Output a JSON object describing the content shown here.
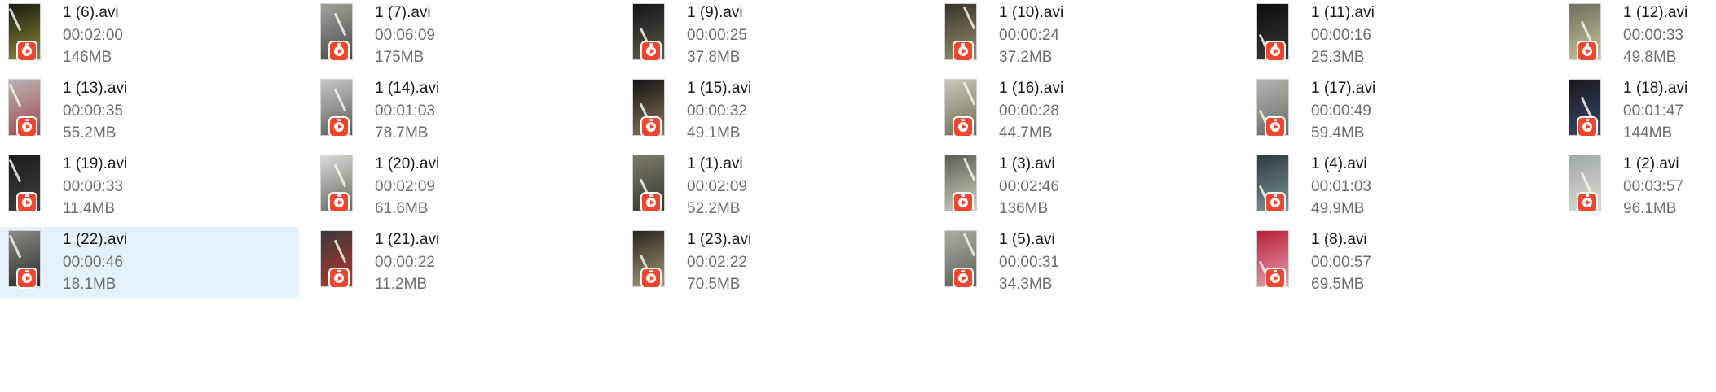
{
  "icons": {
    "play_badge": "video-player-badge-icon"
  },
  "colors": {
    "selection_background": "#e5f1fb",
    "badge_red": "#f0452e",
    "name_text": "#1a1a1a",
    "detail_text": "#6d6d6d"
  },
  "files": [
    {
      "name": "1 (6).avi",
      "duration": "00:02:00",
      "size": "146MB",
      "selected": false,
      "thumb_tones": [
        "#1b1c12",
        "#8b8a38"
      ]
    },
    {
      "name": "1 (7).avi",
      "duration": "00:06:09",
      "size": "175MB",
      "selected": false,
      "thumb_tones": [
        "#9fa399",
        "#4a4b45"
      ]
    },
    {
      "name": "1 (9).avi",
      "duration": "00:00:25",
      "size": "37.8MB",
      "selected": false,
      "thumb_tones": [
        "#151515",
        "#5e5a4d"
      ]
    },
    {
      "name": "1 (10).avi",
      "duration": "00:00:24",
      "size": "37.2MB",
      "selected": false,
      "thumb_tones": [
        "#37332a",
        "#9a8f70"
      ]
    },
    {
      "name": "1 (11).avi",
      "duration": "00:00:16",
      "size": "25.3MB",
      "selected": false,
      "thumb_tones": [
        "#0c0c0c",
        "#3a3a3a"
      ]
    },
    {
      "name": "1 (12).avi",
      "duration": "00:00:33",
      "size": "49.8MB",
      "selected": false,
      "thumb_tones": [
        "#6e6e62",
        "#c8c39a"
      ]
    },
    {
      "name": "1 (13).avi",
      "duration": "00:00:35",
      "size": "55.2MB",
      "selected": false,
      "thumb_tones": [
        "#b9b3b2",
        "#a04750"
      ]
    },
    {
      "name": "1 (14).avi",
      "duration": "00:01:03",
      "size": "78.7MB",
      "selected": false,
      "thumb_tones": [
        "#c7c7c2",
        "#5d5d57"
      ]
    },
    {
      "name": "1 (15).avi",
      "duration": "00:00:32",
      "size": "49.1MB",
      "selected": false,
      "thumb_tones": [
        "#161616",
        "#8a7358"
      ]
    },
    {
      "name": "1 (16).avi",
      "duration": "00:00:28",
      "size": "44.7MB",
      "selected": false,
      "thumb_tones": [
        "#c9c7b8",
        "#6f6a55"
      ]
    },
    {
      "name": "1 (17).avi",
      "duration": "00:00:49",
      "size": "59.4MB",
      "selected": false,
      "thumb_tones": [
        "#b3b5ae",
        "#6a6c65"
      ]
    },
    {
      "name": "1 (18).avi",
      "duration": "00:01:47",
      "size": "144MB",
      "selected": false,
      "thumb_tones": [
        "#17191e",
        "#3a4a6a"
      ]
    },
    {
      "name": "1 (19).avi",
      "duration": "00:00:33",
      "size": "11.4MB",
      "selected": false,
      "thumb_tones": [
        "#1c1c1c",
        "#404040"
      ]
    },
    {
      "name": "1 (20).avi",
      "duration": "00:02:09",
      "size": "61.6MB",
      "selected": false,
      "thumb_tones": [
        "#dadad4",
        "#6a6a62"
      ]
    },
    {
      "name": "1 (1).avi",
      "duration": "00:02:09",
      "size": "52.2MB",
      "selected": false,
      "thumb_tones": [
        "#7c7b6c",
        "#36352d"
      ]
    },
    {
      "name": "1 (3).avi",
      "duration": "00:02:46",
      "size": "136MB",
      "selected": false,
      "thumb_tones": [
        "#5c5d52",
        "#d0cfc0"
      ]
    },
    {
      "name": "1 (4).avi",
      "duration": "00:01:03",
      "size": "49.9MB",
      "selected": false,
      "thumb_tones": [
        "#2e3b3e",
        "#7f9498"
      ]
    },
    {
      "name": "1 (2).avi",
      "duration": "00:03:57",
      "size": "96.1MB",
      "selected": false,
      "thumb_tones": [
        "#9eaaa2",
        "#dadcd2"
      ]
    },
    {
      "name": "1 (22).avi",
      "duration": "00:00:46",
      "size": "18.1MB",
      "selected": true,
      "thumb_tones": [
        "#8b8a86",
        "#2c2c2a"
      ]
    },
    {
      "name": "1 (21).avi",
      "duration": "00:00:22",
      "size": "11.2MB",
      "selected": false,
      "thumb_tones": [
        "#3a3a38",
        "#b8352e"
      ]
    },
    {
      "name": "1 (23).avi",
      "duration": "00:02:22",
      "size": "70.5MB",
      "selected": false,
      "thumb_tones": [
        "#2a2620",
        "#a8987a"
      ]
    },
    {
      "name": "1 (5).avi",
      "duration": "00:00:31",
      "size": "34.3MB",
      "selected": false,
      "thumb_tones": [
        "#a9ada2",
        "#5b6158"
      ]
    },
    {
      "name": "1 (8).avi",
      "duration": "00:00:57",
      "size": "69.5MB",
      "selected": false,
      "thumb_tones": [
        "#b8203a",
        "#e8a0b0"
      ]
    }
  ]
}
